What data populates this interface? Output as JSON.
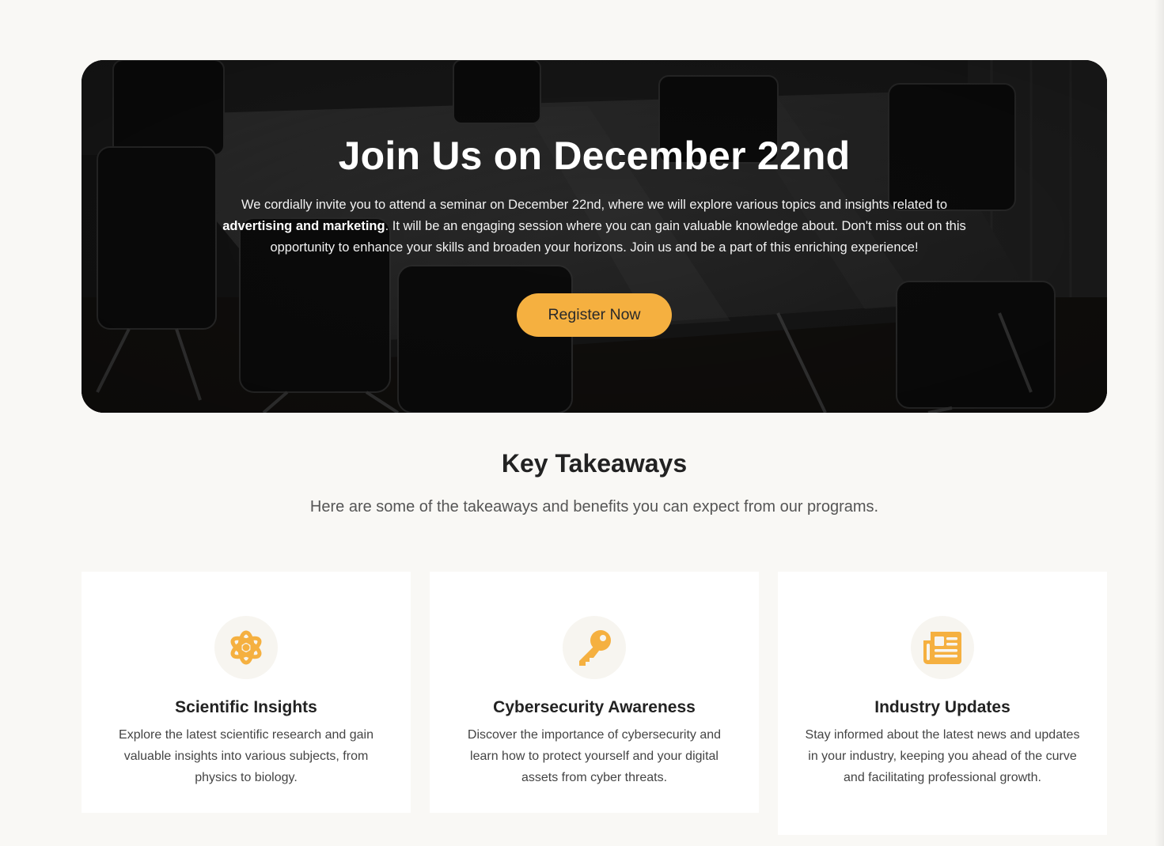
{
  "hero": {
    "title": "Join Us on December 22nd",
    "text_before": "We cordially invite you to attend a seminar on December 22nd, where we will explore various topics and insights related to ",
    "text_bold": "advertising and marketing",
    "text_after": ". It will be an engaging session where you can gain valuable knowledge about. Don't miss out on this opportunity to enhance your skills and broaden your horizons. Join us and be a part of this enriching experience!",
    "button_label": "Register Now",
    "background_image": "conference-room-photo"
  },
  "takeaways": {
    "title": "Key Takeaways",
    "subtitle": "Here are some of the takeaways and benefits you can expect from our programs.",
    "cards": [
      {
        "icon": "atom-icon",
        "title": "Scientific Insights",
        "text": "Explore the latest scientific research and gain valuable insights into various subjects, from physics to biology."
      },
      {
        "icon": "key-icon",
        "title": "Cybersecurity Awareness",
        "text": "Discover the importance of cybersecurity and learn how to protect yourself and your digital assets from cyber threats."
      },
      {
        "icon": "newspaper-icon",
        "title": "Industry Updates",
        "text": "Stay informed about the latest news and updates in your industry, keeping you ahead of the curve and facilitating professional growth."
      }
    ]
  },
  "colors": {
    "accent": "#f5b040",
    "page_background": "#f9f8f5",
    "card_background": "#ffffff"
  }
}
